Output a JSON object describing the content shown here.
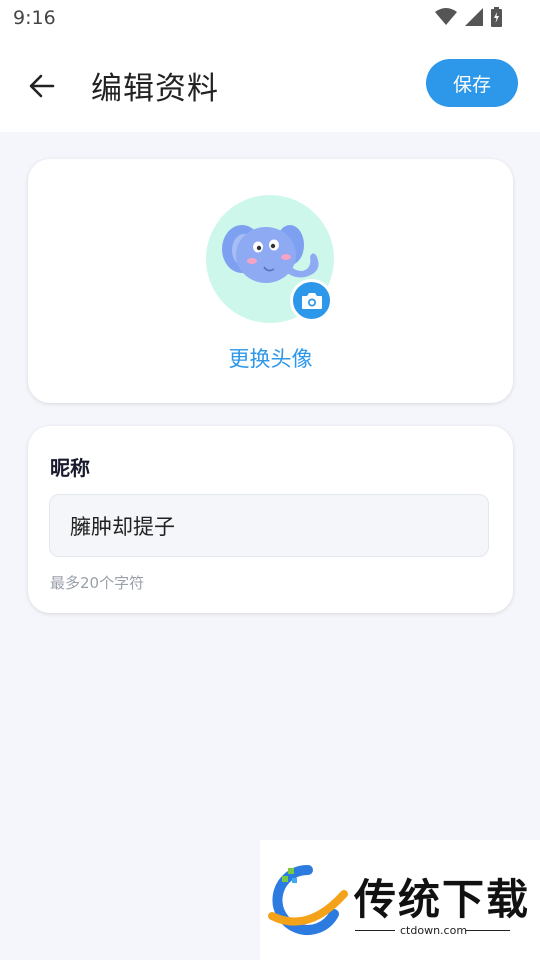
{
  "status_bar": {
    "time": "9:16",
    "icons": [
      "wifi-icon",
      "signal-icon",
      "battery-charging-icon"
    ]
  },
  "header": {
    "title": "编辑资料",
    "save_label": "保存",
    "back_icon": "arrow-left-icon"
  },
  "avatar_section": {
    "change_label": "更换头像",
    "camera_icon": "camera-icon",
    "avatar_bg": "#cef7ec"
  },
  "nickname_section": {
    "label": "昵称",
    "value": "臃肿却提子",
    "hint": "最多20个字符"
  },
  "watermark": {
    "brand": "传统下载",
    "url": "ctdown.com"
  },
  "colors": {
    "accent": "#2d97ea",
    "background": "#f4f6fb"
  }
}
